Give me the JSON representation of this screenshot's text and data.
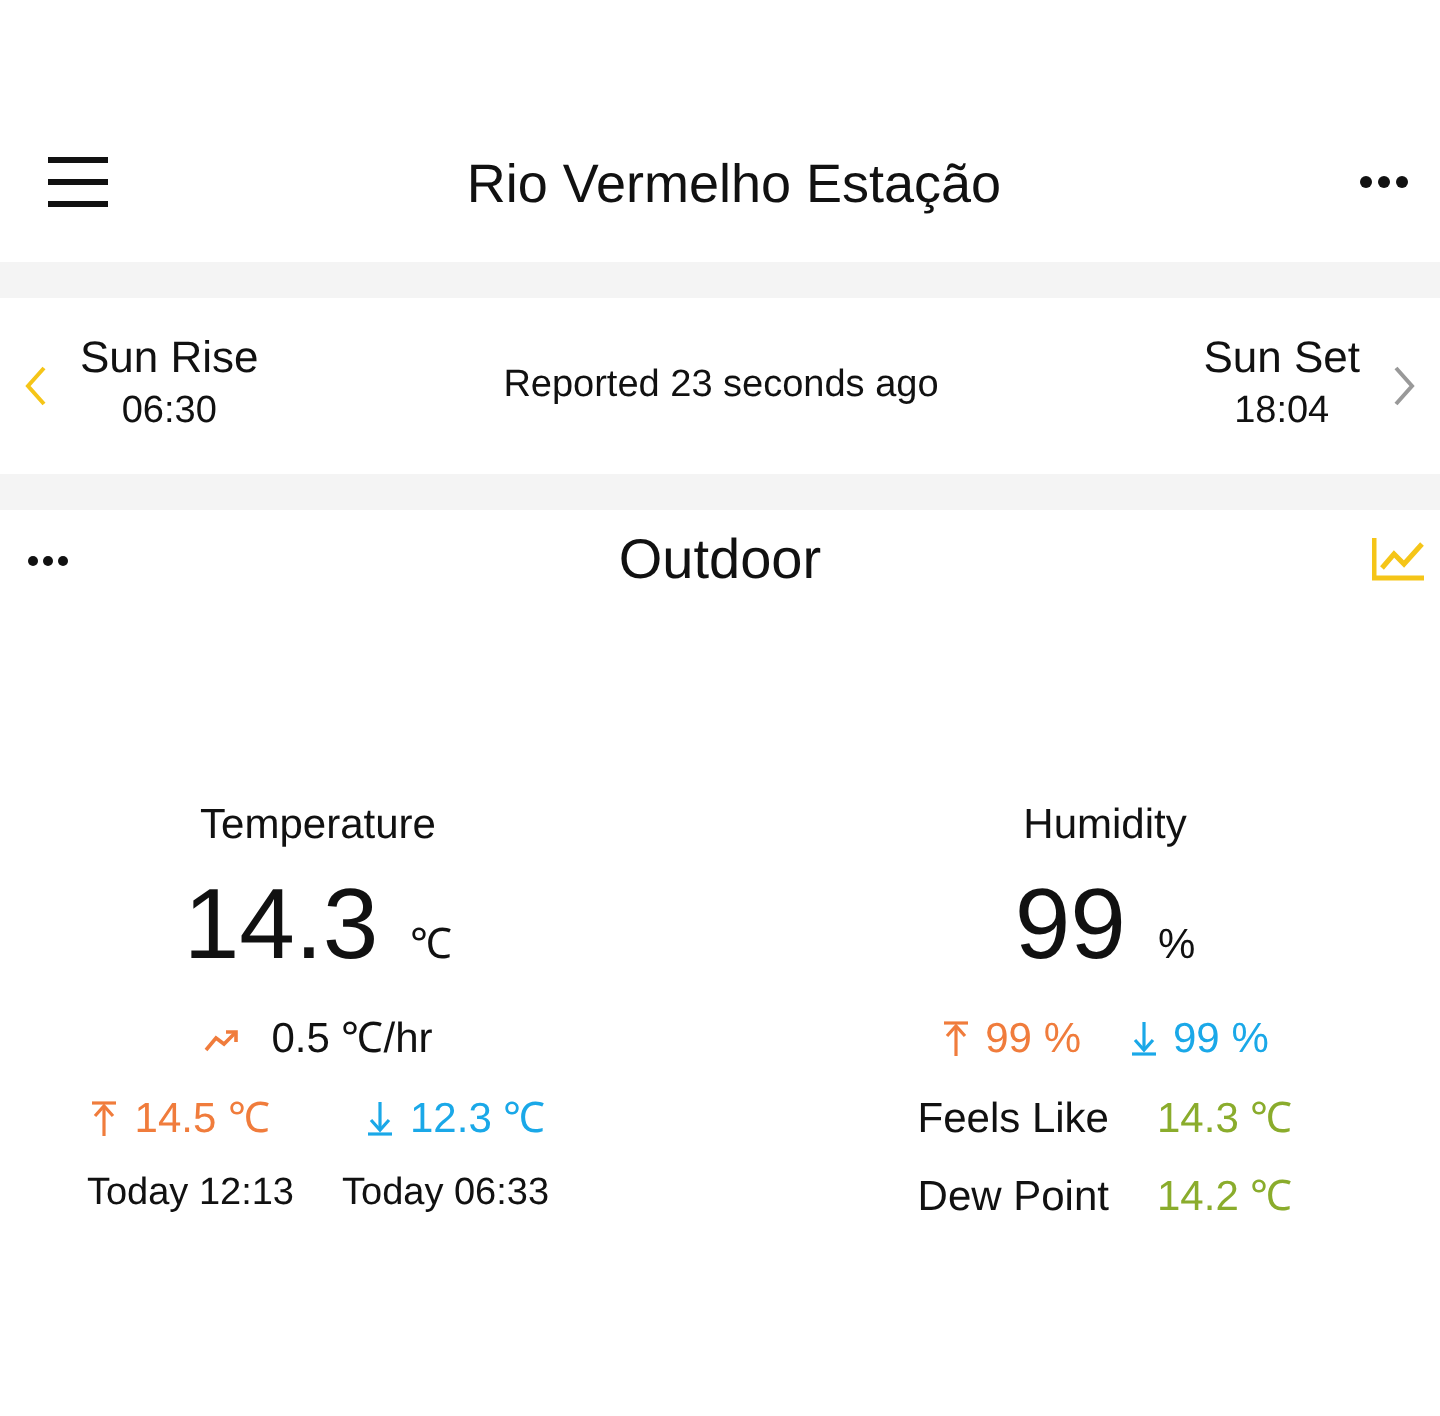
{
  "header": {
    "title": "Rio Vermelho Estação"
  },
  "sun": {
    "rise_label": "Sun Rise",
    "rise_time": "06:30",
    "reported": "Reported 23 seconds ago",
    "set_label": "Sun Set",
    "set_time": "18:04"
  },
  "panel": {
    "title": "Outdoor"
  },
  "temperature": {
    "label": "Temperature",
    "value": "14.3",
    "unit": "℃",
    "trend": "0.5 ℃/hr",
    "high": "14.5 ℃",
    "low": "12.3 ℃",
    "high_time": "Today 12:13",
    "low_time": "Today 06:33"
  },
  "humidity": {
    "label": "Humidity",
    "value": "99",
    "unit": "%",
    "high": "99 %",
    "low": "99 %",
    "details": [
      {
        "label": "Feels Like",
        "value": "14.3 ℃"
      },
      {
        "label": "Dew Point",
        "value": "14.2 ℃"
      }
    ]
  }
}
